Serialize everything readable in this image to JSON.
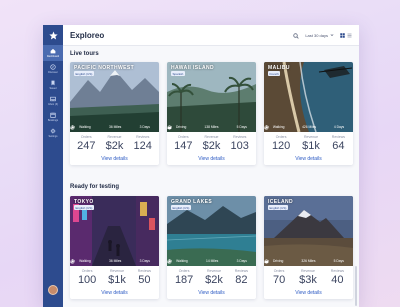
{
  "app": {
    "title": "Exploreo"
  },
  "sidebar": {
    "items": [
      {
        "label": "Dashboard",
        "icon": "dashboard-icon",
        "active": true
      },
      {
        "label": "Discover",
        "icon": "compass-icon"
      },
      {
        "label": "Saved",
        "icon": "bookmark-icon"
      },
      {
        "label": "Inbox (3)",
        "icon": "inbox-icon"
      },
      {
        "label": "Bookings",
        "icon": "calendar-icon"
      },
      {
        "label": "Settings",
        "icon": "gear-icon"
      }
    ]
  },
  "toolbar": {
    "range_label": "Last 30 days"
  },
  "sections": [
    {
      "title": "Live tours",
      "cards": [
        {
          "name": "PACIFIC NORTHWEST",
          "tag": "English (US)",
          "mode": "Walking",
          "distance": "36 Miles",
          "duration": "3 Days",
          "orders_label": "Orders",
          "orders": "247",
          "revenue_label": "Revenue",
          "revenue": "$2k",
          "reviews_label": "Reviews",
          "reviews": "124",
          "link": "View details"
        },
        {
          "name": "HAWAII ISLAND",
          "tag": "Spanish",
          "mode": "Driving",
          "distance": "138 Miles",
          "duration": "5 Days",
          "orders_label": "Orders",
          "orders": "147",
          "revenue_label": "Revenue",
          "revenue": "$2k",
          "reviews_label": "Reviews",
          "reviews": "103",
          "link": "View details"
        },
        {
          "name": "MALIBU",
          "tag": "French",
          "mode": "Walking",
          "distance": "426 Miles",
          "duration": "4 Days",
          "orders_label": "Orders",
          "orders": "120",
          "revenue_label": "Revenue",
          "revenue": "$1k",
          "reviews_label": "Reviews",
          "reviews": "64",
          "link": "View details"
        }
      ]
    },
    {
      "title": "Ready for testing",
      "cards": [
        {
          "name": "TOKYO",
          "tag": "English (US)",
          "mode": "Walking",
          "distance": "36 Miles",
          "duration": "3 Days",
          "orders_label": "Orders",
          "orders": "100",
          "revenue_label": "Revenue",
          "revenue": "$1k",
          "reviews_label": "Reviews",
          "reviews": "50",
          "link": "View details"
        },
        {
          "name": "GRAND LAKES",
          "tag": "English (US)",
          "mode": "Walking",
          "distance": "14 Miles",
          "duration": "3 Days",
          "orders_label": "Orders",
          "orders": "187",
          "revenue_label": "Revenue",
          "revenue": "$2k",
          "reviews_label": "Reviews",
          "reviews": "82",
          "link": "View details"
        },
        {
          "name": "ICELAND",
          "tag": "English (US)",
          "mode": "Driving",
          "distance": "326 Miles",
          "duration": "5 Days",
          "orders_label": "Orders",
          "orders": "70",
          "revenue_label": "Revenue",
          "revenue": "$3k",
          "reviews_label": "Reviews",
          "reviews": "40",
          "link": "View details"
        }
      ]
    }
  ]
}
